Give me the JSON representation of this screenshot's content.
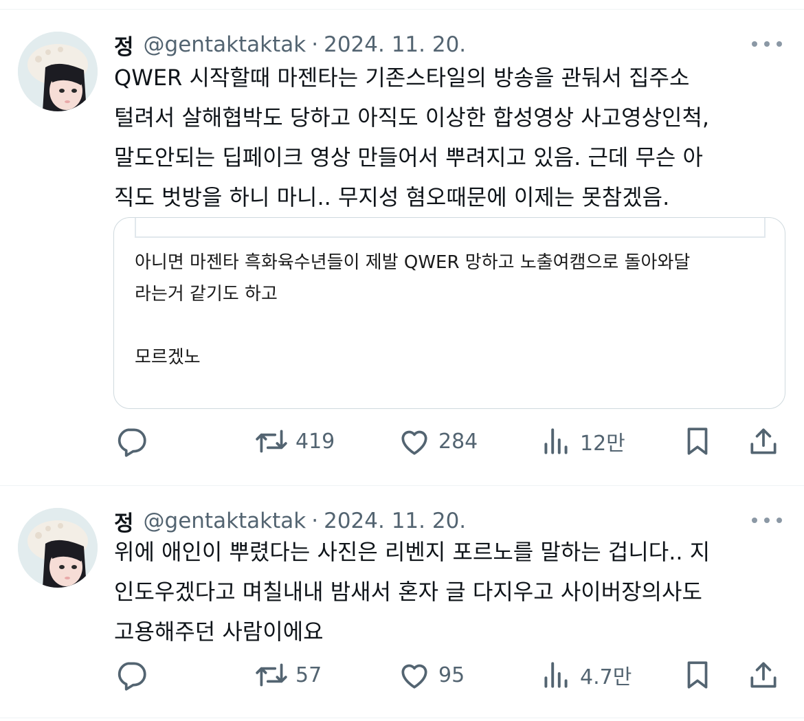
{
  "tweets": [
    {
      "display_name": "정",
      "handle": "@gentaktaktak",
      "separator": "·",
      "date": "2024. 11. 20.",
      "text": "QWER 시작할때 마젠타는 기존스타일의 방송을 관둬서 집주소\n털려서 살해협박도 당하고 아직도 이상한 합성영상 사고영상인척,\n말도안되는 딥페이크 영상 만들어서 뿌려지고 있음. 근데 무슨 아\n직도 벗방을 하니 마니.. 무지성 혐오때문에 이제는 못참겠음.",
      "quote_text": "아니면 마젠타 흑화육수년들이 제발 QWER 망하고 노출여캠으로 돌아와달\n라는거 같기도 하고\n\n모르겠노",
      "retweets": "419",
      "likes": "284",
      "views": "12만"
    },
    {
      "display_name": "정",
      "handle": "@gentaktaktak",
      "separator": "·",
      "date": "2024. 11. 20.",
      "text": "위에 애인이 뿌렸다는 사진은 리벤지 포르노를 말하는 겁니다.. 지\n인도우겠다고 며칠내내 밤새서 혼자 글 다지우고 사이버장의사도\n고용해주던 사람이에요",
      "retweets": "57",
      "likes": "95",
      "views": "4.7만"
    }
  ],
  "icons": {
    "reply": "reply-icon",
    "retweet": "retweet-icon",
    "like": "heart-icon",
    "views": "views-icon",
    "bookmark": "bookmark-icon",
    "share": "share-icon",
    "more": "more-icon"
  },
  "colors": {
    "text": "#0f1419",
    "secondary": "#536471",
    "icon": "#536471",
    "border": "#cfd9de"
  }
}
